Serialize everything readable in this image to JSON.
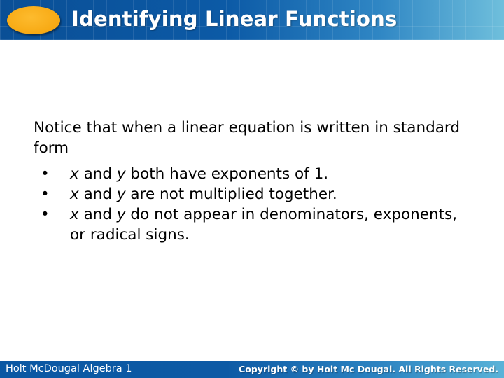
{
  "header": {
    "title": "Identifying Linear Functions",
    "accent_color": "#f7a913",
    "bar_color": "#0c5aa6"
  },
  "content": {
    "intro": "Notice that when a linear equation is written in standard form",
    "bullets": [
      {
        "var1": "x",
        "mid": " and ",
        "var2": "y",
        "rest": " both have exponents of 1."
      },
      {
        "var1": "x",
        "mid": " and ",
        "var2": "y",
        "rest": " are not multiplied together."
      },
      {
        "var1": "x",
        "mid": " and ",
        "var2": "y",
        "rest": " do not appear in denominators, exponents, or radical signs."
      }
    ],
    "bullet_glyph": "•"
  },
  "footer": {
    "left": "Holt McDougal Algebra 1",
    "right": "Copyright © by Holt Mc Dougal. All Rights Reserved."
  }
}
